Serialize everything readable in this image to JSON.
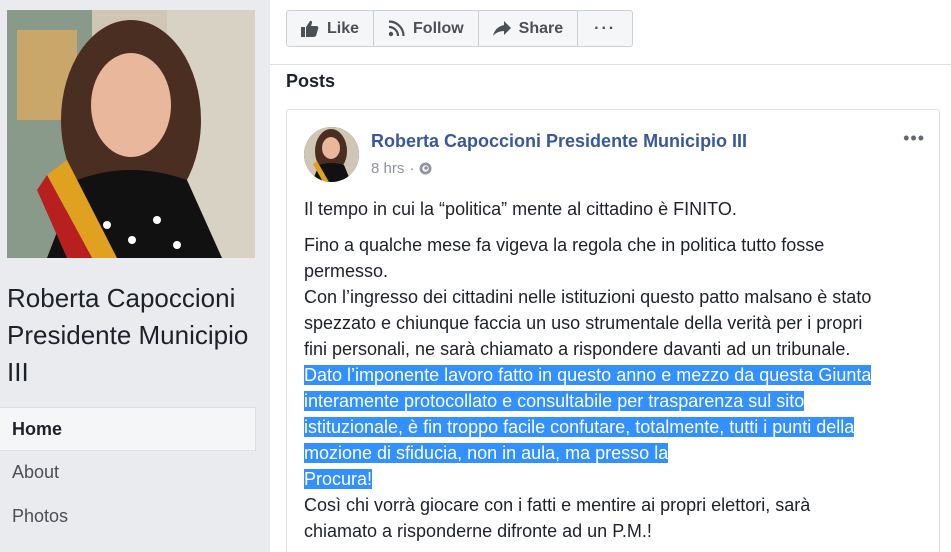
{
  "profile": {
    "name": "Roberta Capoccioni Presidente Municipio III"
  },
  "nav": {
    "items": [
      {
        "label": "Home",
        "active": true
      },
      {
        "label": "About",
        "active": false
      },
      {
        "label": "Photos",
        "active": false
      }
    ]
  },
  "actions": {
    "like": "Like",
    "follow": "Follow",
    "share": "Share",
    "more": "···"
  },
  "posts_title": "Posts",
  "post": {
    "author": "Roberta Capoccioni Presidente Municipio III",
    "time": "8 hrs",
    "dot": "·",
    "more": "•••",
    "para1": "Il tempo in cui la “politica” mente al cittadino è FINITO.",
    "para2_lines": [
      "Fino a qualche mese fa vigeva la regola che in politica tutto fosse",
      "permesso.",
      "Con l’ingresso dei cittadini nelle istituzioni questo patto malsano è stato",
      "spezzato e chiunque faccia un uso strumentale della verità per i propri",
      "fini personali, ne sarà chiamato a rispondere davanti ad un tribunale."
    ],
    "highlight_lines": [
      "Dato l’imponente lavoro fatto in questo anno e mezzo da questa Giunta",
      "interamente protocollato e consultabile per trasparenza sul sito",
      "istituzionale, è fin troppo facile confutare, totalmente, tutti i punti della",
      "mozione di sfiducia, non in aula, ma presso la",
      "Procura!"
    ],
    "tail_lines": [
      "Così chi vorrà giocare con i fatti e mentire ai propri elettori, sarà",
      "chiamato a risponderne difronte ad un P.M.!"
    ]
  },
  "colors": {
    "link": "#385898",
    "highlight": "#3390ff",
    "background": "#e9ebee"
  },
  "icons": {
    "like": "thumbs-up-icon",
    "follow": "rss-icon",
    "share": "share-arrow-icon",
    "privacy": "globe-icon"
  }
}
